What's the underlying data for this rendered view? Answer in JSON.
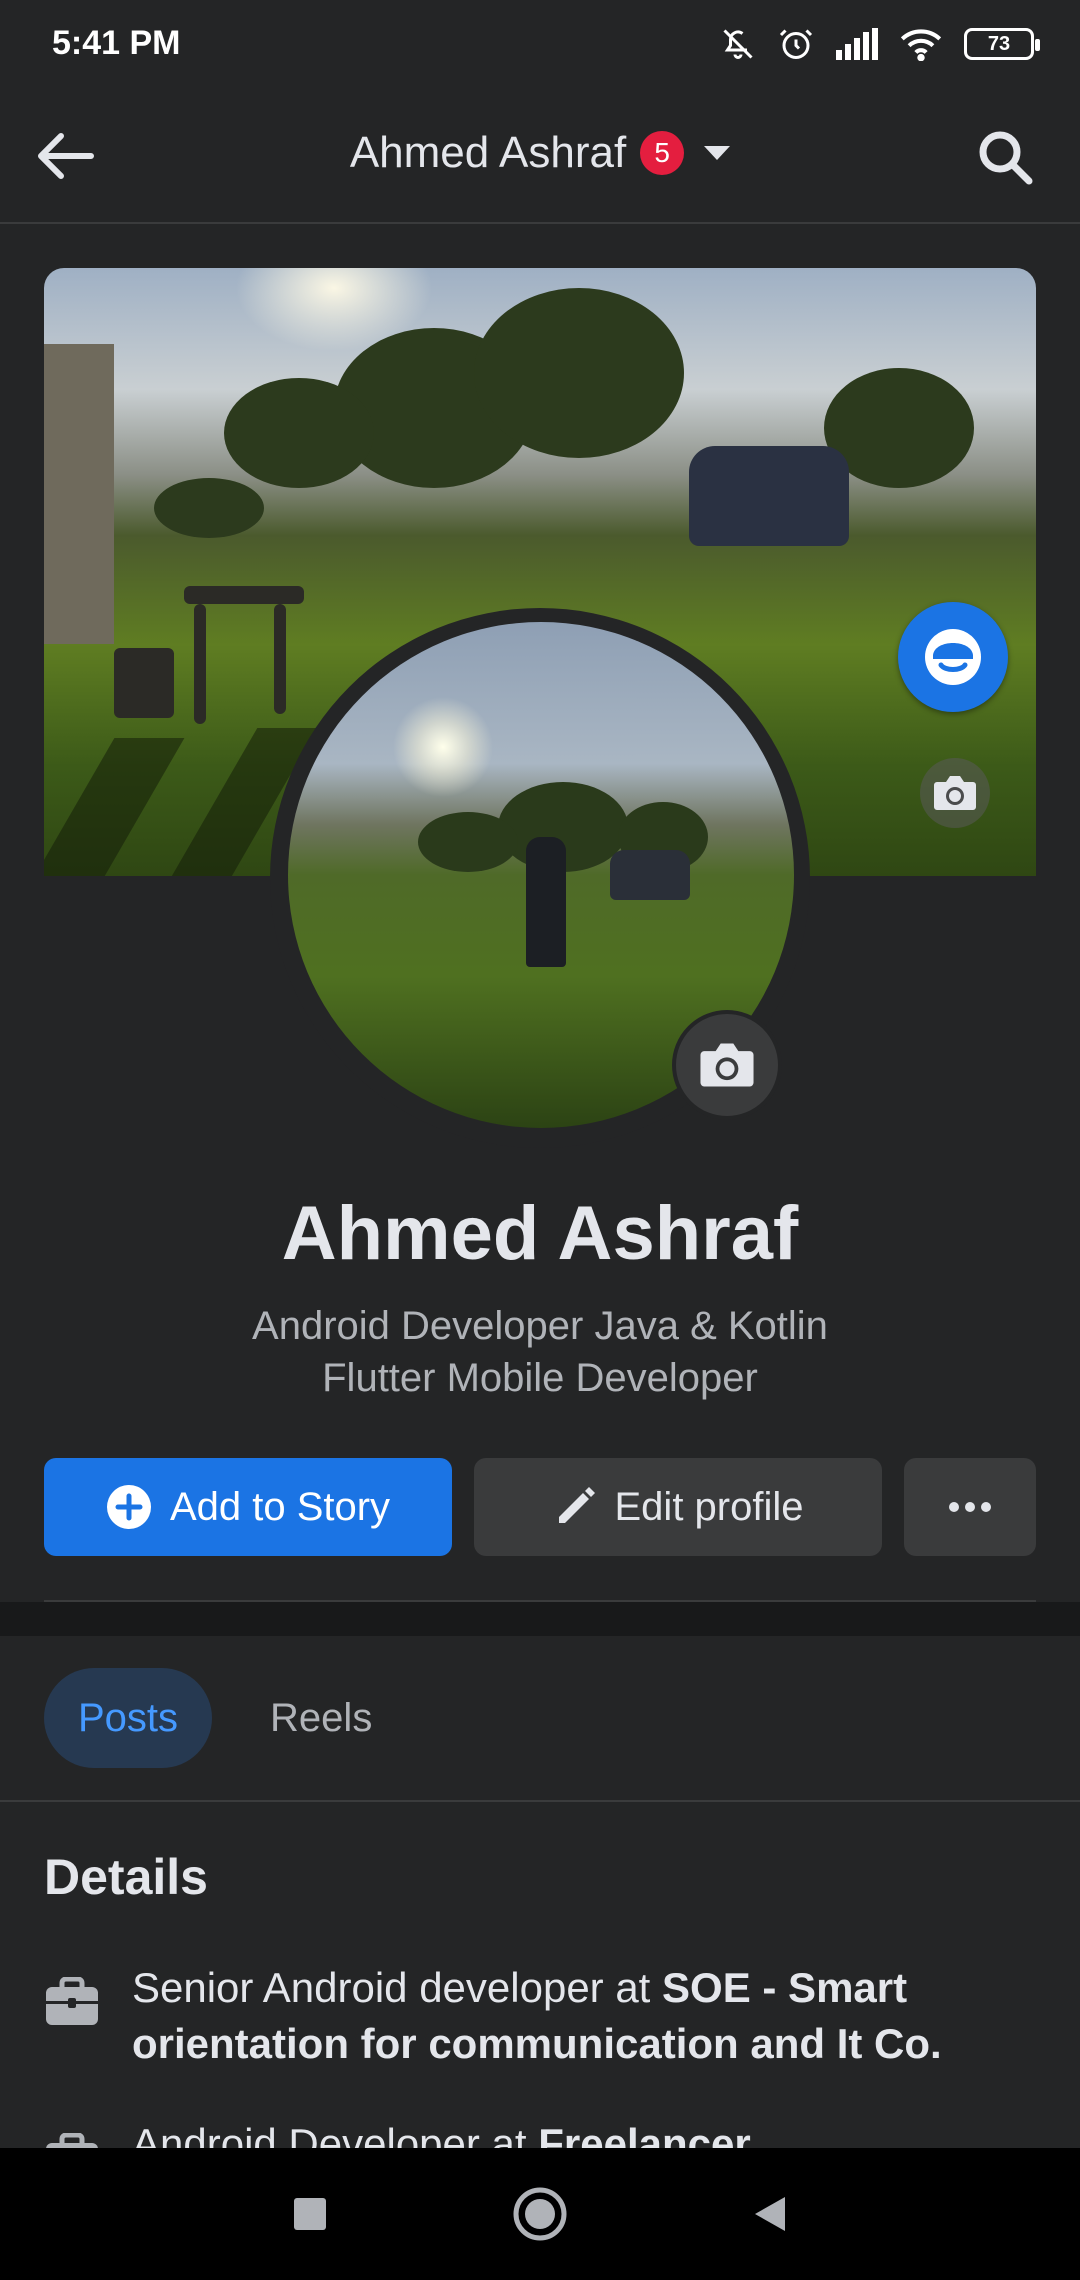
{
  "status_bar": {
    "time": "5:41 PM",
    "battery": "73",
    "icons": [
      "mute-icon",
      "alarm-icon",
      "signal-icon",
      "wifi-icon",
      "battery-icon"
    ]
  },
  "header": {
    "title": "Ahmed Ashraf",
    "notification_count": "5"
  },
  "profile": {
    "name": "Ahmed Ashraf",
    "bio_line1": "Android Developer Java & Kotlin",
    "bio_line2": "Flutter Mobile Developer"
  },
  "actions": {
    "add_story": "Add to Story",
    "edit_profile": "Edit profile",
    "more": "•••"
  },
  "tabs": [
    {
      "label": "Posts",
      "active": true
    },
    {
      "label": "Reels",
      "active": false
    }
  ],
  "details": {
    "title": "Details",
    "items": [
      {
        "prefix": "Senior Android developer at ",
        "emphasis": "SOE - Smart orientation for communication and It Co."
      },
      {
        "prefix": "Android Developer at ",
        "emphasis": "Freelancer"
      }
    ]
  },
  "colors": {
    "background": "#242526",
    "primary": "#1b74e4",
    "badge": "#e41e3f",
    "tab_active_text": "#4599ff"
  }
}
